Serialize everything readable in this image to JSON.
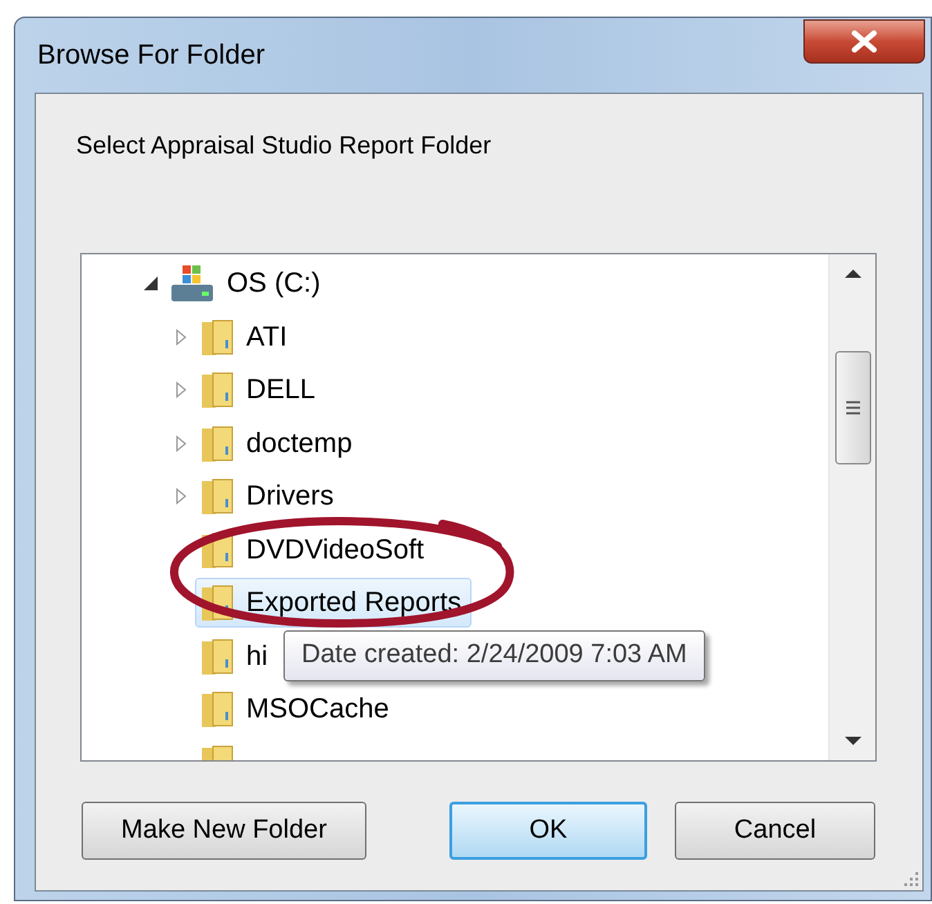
{
  "window": {
    "title": "Browse For Folder"
  },
  "prompt": "Select Appraisal Studio Report Folder",
  "tree": [
    {
      "label": "OS (C:)",
      "kind": "drive",
      "expanded": true,
      "children": [
        {
          "label": "ATI",
          "kind": "folder",
          "expandable": true,
          "highlighted": false
        },
        {
          "label": "DELL",
          "kind": "folder",
          "expandable": true,
          "highlighted": false
        },
        {
          "label": "doctemp",
          "kind": "folder",
          "expandable": true,
          "highlighted": false
        },
        {
          "label": "Drivers",
          "kind": "folder",
          "expandable": true,
          "highlighted": false
        },
        {
          "label": "DVDVideoSoft",
          "kind": "folder",
          "expandable": false,
          "highlighted": false
        },
        {
          "label": "Exported Reports",
          "kind": "folder",
          "expandable": false,
          "highlighted": true
        },
        {
          "label": "hi",
          "kind": "folder",
          "expandable": false,
          "highlighted": false
        },
        {
          "label": "MSOCache",
          "kind": "folder",
          "expandable": false,
          "highlighted": false
        },
        {
          "kind": "folder",
          "expandable": false,
          "highlighted": false
        }
      ]
    }
  ],
  "tooltip": "Date created: 2/24/2009 7:03 AM",
  "buttons": [
    {
      "label": "Make New Folder",
      "default": false
    },
    {
      "label": "OK",
      "default": true
    },
    {
      "label": "Cancel",
      "default": false
    }
  ]
}
